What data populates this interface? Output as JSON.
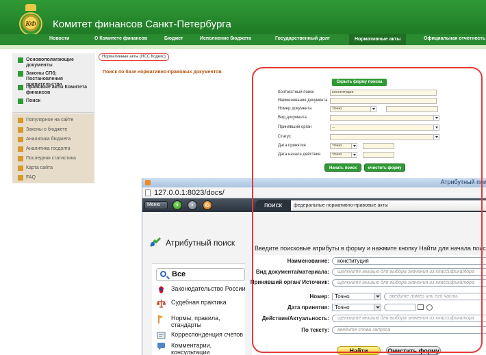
{
  "site": {
    "title": "Комитет финансов Санкт-Петербурга",
    "logo_text": "КФ",
    "nav": [
      "Новости",
      "О Комитете финансов",
      "Бюджет",
      "Исполнение бюджета",
      "Государственный долг",
      "Нормативные акты",
      "Официальная отчетность"
    ],
    "sidebar_main": [
      "Основополагающие документы",
      "Законы СПб; Постановления правительства",
      "Правовые акты Комитета финансов",
      "Поиск"
    ],
    "sidebar_secondary": [
      "Популярное на сайте",
      "Законы о бюджете",
      "Аналитика бюджета",
      "Аналитика госдолга",
      "Последняя статистика",
      "Карта сайта",
      "FAQ"
    ],
    "breadcrumb": "Нормативные акты (ИСС Кодекс)",
    "heading": "Поиск по базе нормативно-правовых документов",
    "form": {
      "hide_button": "Скрыть форму поиска",
      "fields": [
        {
          "label": "Контекстный поиск",
          "value": "конституция"
        },
        {
          "label": "Наименование документа",
          "value": ""
        },
        {
          "label": "Номер документа",
          "value": "точно"
        },
        {
          "label": "Вид документа",
          "value": ""
        },
        {
          "label": "Принявший орган",
          "value": "..."
        },
        {
          "label": "Статус",
          "value": ""
        },
        {
          "label": "Дата принятия",
          "value": "точно"
        },
        {
          "label": "Дата начала действия",
          "value": "точно"
        }
      ],
      "start_button": "Начать поиск",
      "clear_button": "очистить форму"
    },
    "colors": {
      "brand": "#2f9a35",
      "highlight": "#e53935",
      "heading": "#b5540b"
    }
  },
  "browser": {
    "window_title": "Атрибутный пои",
    "url": "127.0.0.1:8023/docs/",
    "menu_label": "Меню",
    "search_tab": "поиск",
    "search_value": "федеральные нормативно-правовые акты",
    "left_panel": {
      "title": "Атрибутный поиск",
      "all": "Все",
      "items": [
        {
          "label": "Законодательство России",
          "icon": "russia-emblem-icon"
        },
        {
          "label": "Судебная практика",
          "icon": "scales-icon"
        },
        {
          "label": "Нормы, правила, стандарты",
          "icon": "flag-icon"
        },
        {
          "label": "Корреспонденция счетов",
          "icon": "accounts-icon"
        },
        {
          "label": "Комментарии, консультации",
          "icon": "comments-icon"
        }
      ]
    },
    "instructions": "Введите поисковые атрибуты в форму и нажмите кнопку Найти для начала поиска",
    "form": {
      "name_label": "Наименование:",
      "name_value": "конституция",
      "doctype_label": "Вид документа/материала:",
      "doctype_placeholder": "щелкните мышью для выбора значения из классификатора",
      "authority_label": "Принявший орган/ Источник:",
      "authority_placeholder": "щелкните мышью для выбора значения из классификатора",
      "number_label": "Номер:",
      "number_mode": "Точно",
      "number_placeholder": "введите номер или его часть",
      "date_label": "Дата принятия:",
      "date_mode": "Точно",
      "status_label": "Действие/Актуальность:",
      "status_placeholder": "щелкните мышью для выбора значения из классификатора",
      "text_label": "По тексту:",
      "text_placeholder": "введите слова запроса",
      "find_button": "Найти",
      "clear_button": "Очистить форму"
    }
  }
}
